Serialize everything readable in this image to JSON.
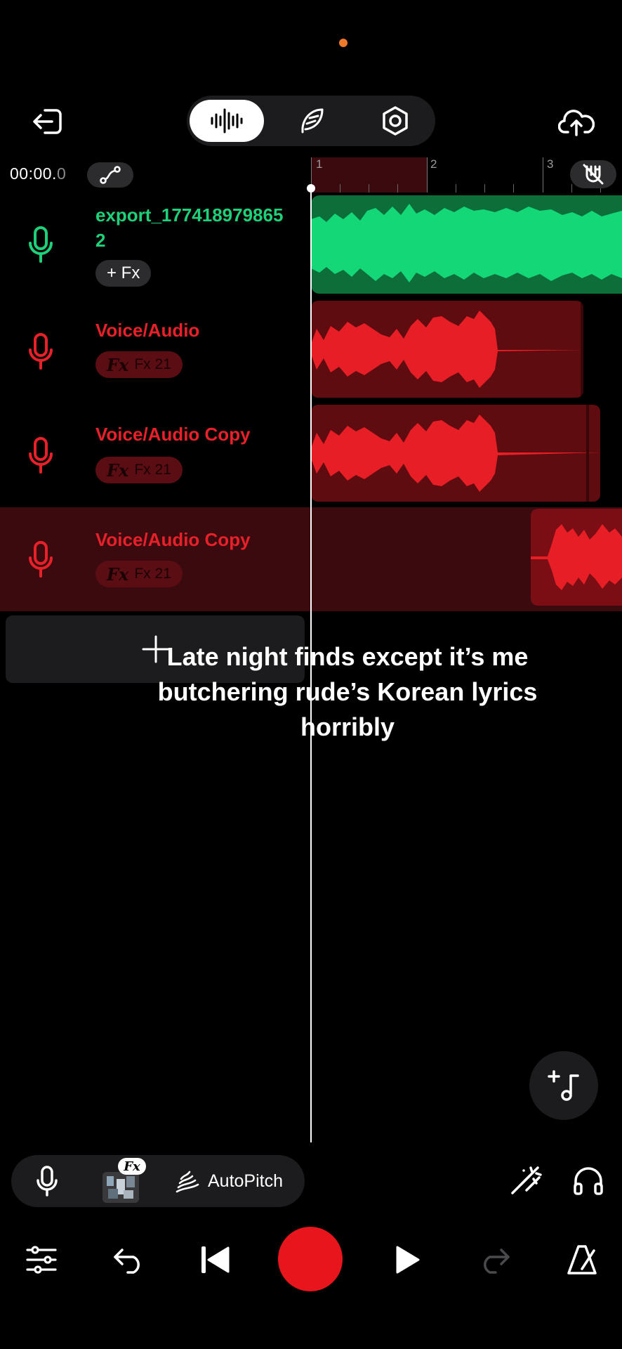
{
  "colors": {
    "accent_green": "#1fd07a",
    "accent_red": "#e8202a",
    "record": "#e8161c",
    "status_dot": "#f07a2a"
  },
  "top_bar": {
    "exit_icon": "exit-icon",
    "modes": [
      "waveform-icon",
      "feather-icon",
      "hexagon-settings-icon"
    ],
    "active_mode": "waveform",
    "upload_icon": "cloud-upload-icon"
  },
  "timeline": {
    "time_main": "00:00.",
    "time_fraction": "0",
    "ruler_numbers": [
      "1",
      "2",
      "3"
    ]
  },
  "tracks": [
    {
      "name": "export_177418979865 2",
      "name_line1": "export_177418979865",
      "name_line2": "2",
      "fx_label": "+ Fx",
      "color": "green",
      "selected": false
    },
    {
      "name": "Voice/Audio",
      "fx_label": "Fx",
      "fx_count": "Fx 21",
      "color": "red",
      "selected": false
    },
    {
      "name": "Voice/Audio Copy",
      "fx_label": "Fx",
      "fx_count": "Fx 21",
      "color": "red",
      "selected": false
    },
    {
      "name": "Voice/Audio Copy",
      "fx_label": "Fx",
      "fx_count": "Fx 21",
      "color": "red",
      "selected": true
    }
  ],
  "add_track_icon": "plus-icon",
  "caption": "Late night finds except it’s me butchering rude’s Korean lyrics horribly",
  "add_note_icon": "add-music-note-icon",
  "tools": {
    "mic_icon": "mic-icon",
    "fx_badge": "Fx",
    "autopitch_label": "AutoPitch",
    "wand_icon": "magic-wand-icon",
    "headphones_icon": "headphones-icon"
  },
  "transport": {
    "mixer_icon": "sliders-icon",
    "undo_icon": "undo-icon",
    "skip_back_icon": "skip-back-icon",
    "record_icon": "record-icon",
    "play_icon": "play-icon",
    "redo_icon": "redo-icon",
    "metronome_icon": "metronome-icon"
  }
}
